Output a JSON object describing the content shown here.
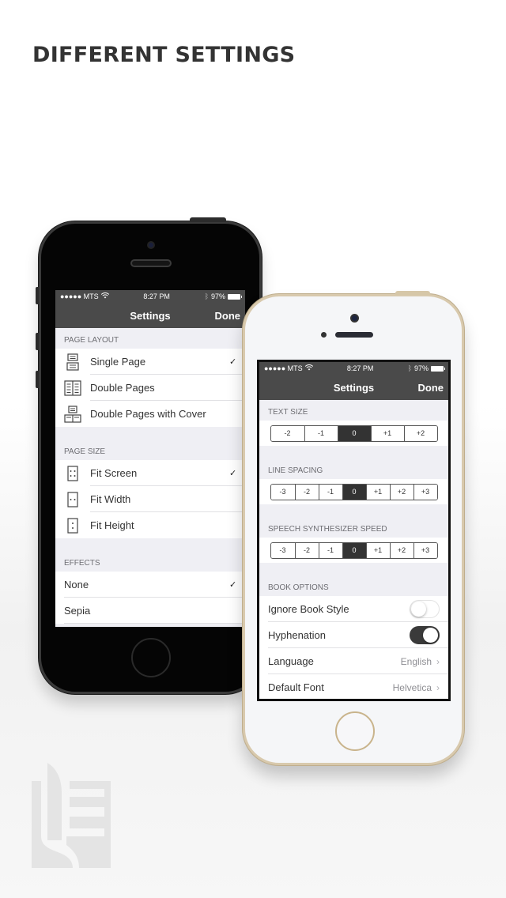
{
  "headline": "DIFFERENT SETTINGS",
  "status_bar": {
    "carrier": "●●●●● MTS",
    "wifi_icon": "wifi",
    "time": "8:27 PM",
    "bluetooth_icon": "bluetooth",
    "battery": "97%"
  },
  "navbar": {
    "title": "Settings",
    "done": "Done"
  },
  "black_phone": {
    "page_layout": {
      "header": "PAGE LAYOUT",
      "items": [
        {
          "label": "Single Page",
          "icon": "single-page-icon",
          "checked": true
        },
        {
          "label": "Double Pages",
          "icon": "double-pages-icon",
          "checked": false
        },
        {
          "label": "Double Pages with Cover",
          "icon": "double-pages-cover-icon",
          "checked": false
        }
      ]
    },
    "page_size": {
      "header": "PAGE SIZE",
      "items": [
        {
          "label": "Fit Screen",
          "icon": "fit-screen-icon",
          "checked": true
        },
        {
          "label": "Fit Width",
          "icon": "fit-width-icon",
          "checked": false
        },
        {
          "label": "Fit Height",
          "icon": "fit-height-icon",
          "checked": false
        }
      ]
    },
    "effects": {
      "header": "EFFECTS",
      "items": [
        {
          "label": "None",
          "checked": true
        },
        {
          "label": "Sepia",
          "checked": false
        }
      ]
    },
    "checkmark": "✓"
  },
  "gold_phone": {
    "text_size": {
      "header": "TEXT SIZE",
      "options": [
        "-2",
        "-1",
        "0",
        "+1",
        "+2"
      ],
      "selected": "0"
    },
    "line_spacing": {
      "header": "LINE SPACING",
      "options": [
        "-3",
        "-2",
        "-1",
        "0",
        "+1",
        "+2",
        "+3"
      ],
      "selected": "0"
    },
    "speech_speed": {
      "header": "SPEECH SYNTHESIZER SPEED",
      "options": [
        "-3",
        "-2",
        "-1",
        "0",
        "+1",
        "+2",
        "+3"
      ],
      "selected": "0"
    },
    "book_options": {
      "header": "BOOK OPTIONS",
      "ignore_book_style": {
        "label": "Ignore Book Style",
        "on": false
      },
      "hyphenation": {
        "label": "Hyphenation",
        "on": true
      },
      "language": {
        "label": "Language",
        "value": "English"
      },
      "default_font": {
        "label": "Default Font",
        "value": "Helvetica"
      }
    },
    "chevron": "›"
  },
  "colors": {
    "bar": "#4a4a4a",
    "selected_segment": "#333333",
    "toggle_on": "#3a3a3a",
    "headline": "#333333"
  }
}
